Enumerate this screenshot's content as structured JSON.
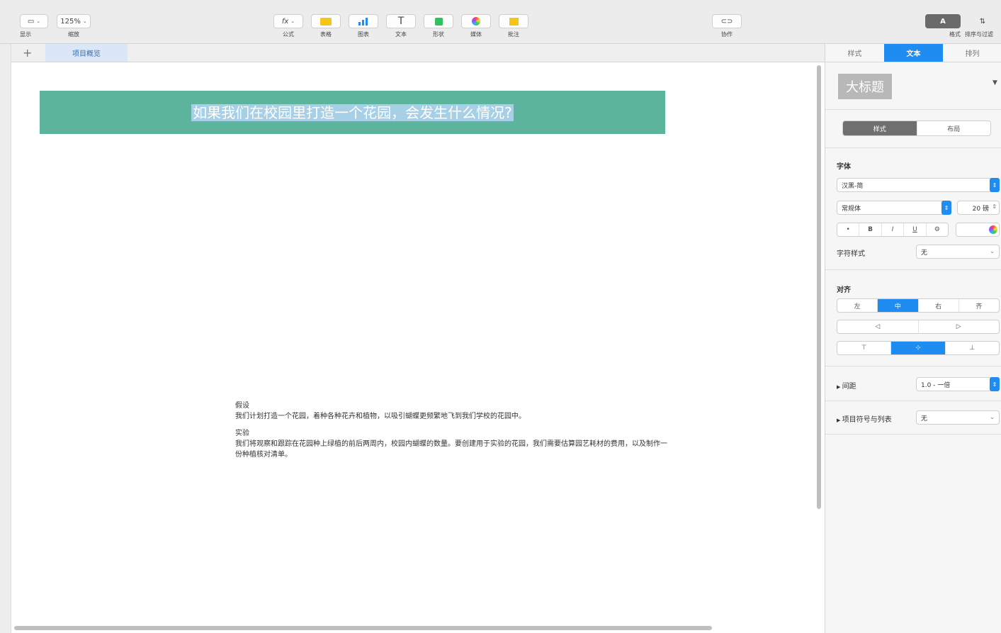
{
  "toolbar": {
    "view": {
      "label": "显示",
      "icon": "sidebar-icon"
    },
    "zoom": {
      "label": "缩放",
      "value": "125%"
    },
    "formula": {
      "label": "公式",
      "icon": "function-icon",
      "glyph": "fx"
    },
    "table": {
      "label": "表格",
      "icon": "table-icon"
    },
    "chart": {
      "label": "图表",
      "icon": "bar-chart-icon"
    },
    "text": {
      "label": "文本",
      "icon": "text-icon",
      "glyph": "T"
    },
    "shape": {
      "label": "形状",
      "icon": "shape-icon"
    },
    "media": {
      "label": "媒体",
      "icon": "media-icon"
    },
    "comment": {
      "label": "批注",
      "icon": "comment-icon"
    },
    "collaborate": {
      "label": "协作",
      "icon": "collaborate-icon"
    },
    "format": {
      "label": "格式",
      "icon": "paintbrush-icon"
    },
    "organize": {
      "label": "排序与过滤",
      "icon": "sort-icon",
      "glyph": "⇅"
    }
  },
  "sheets": {
    "add_label": "+",
    "active_tab": "项目概览"
  },
  "canvas": {
    "title": "如果我们在校园里打造一个花园，会发生什么情况?",
    "paragraphs": [
      {
        "heading": "假设",
        "text": "我们计划打造一个花园，着种各种花卉和植物，以吸引蝴蝶更频繁地飞到我们学校的花园中。"
      },
      {
        "heading": "实验",
        "text": "我们将观察和跟踪在花园种上绿植的前后两周内，校园内蝴蝶的数量。要创建用于实验的花园，我们需要估算园艺耗材的费用，以及制作一份种植核对清单。"
      }
    ]
  },
  "inspector": {
    "tabs": [
      {
        "label": "样式",
        "active": false
      },
      {
        "label": "文本",
        "active": true
      },
      {
        "label": "排列",
        "active": false
      }
    ],
    "paragraph_style": "大标题",
    "subtabs": [
      {
        "label": "样式",
        "active": true
      },
      {
        "label": "布局",
        "active": false
      }
    ],
    "font_section_label": "字体",
    "font_family": "汉黑-简",
    "font_typeface": "常规体",
    "font_size": "20 磅",
    "style_buttons": [
      "•",
      "B",
      "I",
      "U",
      "⚙"
    ],
    "char_style_label": "字符样式",
    "char_style_value": "无",
    "align_label": "对齐",
    "h_align": [
      "左",
      "中",
      "右",
      "齐"
    ],
    "h_align_active": 1,
    "indent": [
      "◁",
      "▷"
    ],
    "v_align": [
      "⊤",
      "⊥"
    ],
    "spacing_label": "间距",
    "spacing_value": "1.0 - 一倍",
    "bullets_label": "项目符号与列表",
    "bullets_value": "无"
  },
  "colors": {
    "accent": "#1e8cf0",
    "banner": "#5cb49c",
    "selection": "#a7cfe6"
  }
}
